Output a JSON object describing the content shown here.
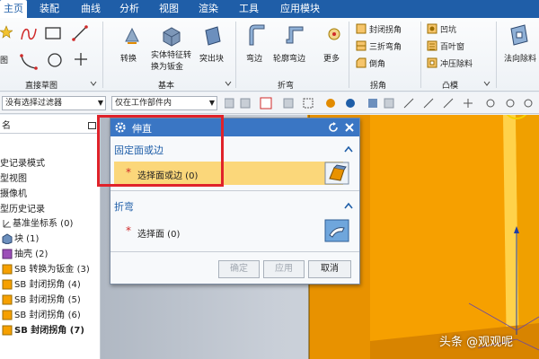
{
  "menu": {
    "tabs": [
      "主页",
      "装配",
      "曲线",
      "分析",
      "视图",
      "渲染",
      "工具",
      "应用模块"
    ]
  },
  "ribbon": {
    "group_sketch": "直接草图",
    "feature_tools": {
      "convert": "转换",
      "solid_to_sheet": "实体特征转换为钣金",
      "tab": "突出块"
    },
    "group_basic": "基本",
    "bend_tools": {
      "flange": "弯边",
      "contour_flange": "轮廓弯边",
      "more": "更多"
    },
    "group_bend": "折弯",
    "corner_tools": [
      "封闭拐角",
      "三折弯角",
      "倒角"
    ],
    "group_corner": "拐角",
    "punch_tools": [
      "凹坑",
      "百叶窗",
      "冲压除料"
    ],
    "group_punch": "凸模",
    "normal_cutout": "法向除料"
  },
  "toolbar2": {
    "filter": "没有选择过滤器",
    "scope": "仅在工作部件内"
  },
  "navigator": {
    "header": "名",
    "items": [
      "史记录模式",
      "型视图",
      "摄像机",
      "型历史记录",
      "基准坐标系 (0)",
      "块 (1)",
      "抽壳 (2)",
      "SB 转换为钣金 (3)",
      "SB 封闭拐角 (4)",
      "SB 封闭拐角 (5)",
      "SB 封闭拐角 (6)",
      "SB 封闭拐角 (7)"
    ]
  },
  "dialog": {
    "title": "伸直",
    "section1": "固定面或边",
    "select_face_edge": "选择面或边 (0)",
    "section2": "折弯",
    "select_face": "选择面 (0)",
    "required_mark": "*",
    "buttons": {
      "ok": "确定",
      "apply": "应用",
      "cancel": "取消"
    }
  },
  "watermark": "头条 @观观呢",
  "colors": {
    "menubar": "#1f5ea8",
    "dialog_title": "#3a76c4",
    "highlight_row": "#fbd77a",
    "part_orange": "#f6a000",
    "red_annotation": "#e0222a"
  }
}
